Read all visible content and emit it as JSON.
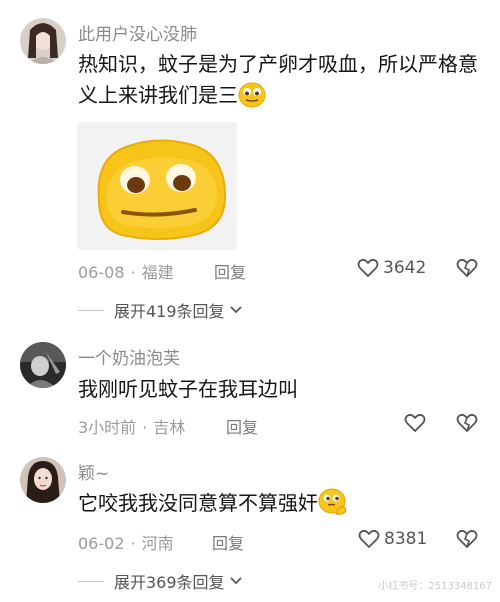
{
  "comments": [
    {
      "username": "此用户没心没肺",
      "text": "热知识，蚊子是为了产卵才吸血，所以严格意义上来讲我们是三",
      "inline_emoji": "smile-eyes-emoji",
      "date": "06-08",
      "location": "福建",
      "reply_label": "回复",
      "likes": "3642",
      "expand_label": "展开419条回复"
    },
    {
      "username": "一个奶油泡芙",
      "text": "我刚听见蚊子在我耳边叫",
      "date": "3小时前",
      "location": "吉林",
      "reply_label": "回复",
      "likes": ""
    },
    {
      "username": "颖~",
      "text": "它咬我我没同意算不算强奸",
      "inline_emoji": "thinking-emoji",
      "date": "06-02",
      "location": "河南",
      "reply_label": "回复",
      "likes": "8381",
      "expand_label": "展开369条回复"
    }
  ],
  "watermark": "小红书号：2513348167",
  "colors": {
    "emoji_yellow": "#f7c51a",
    "muted_text": "#9b9b9b"
  }
}
